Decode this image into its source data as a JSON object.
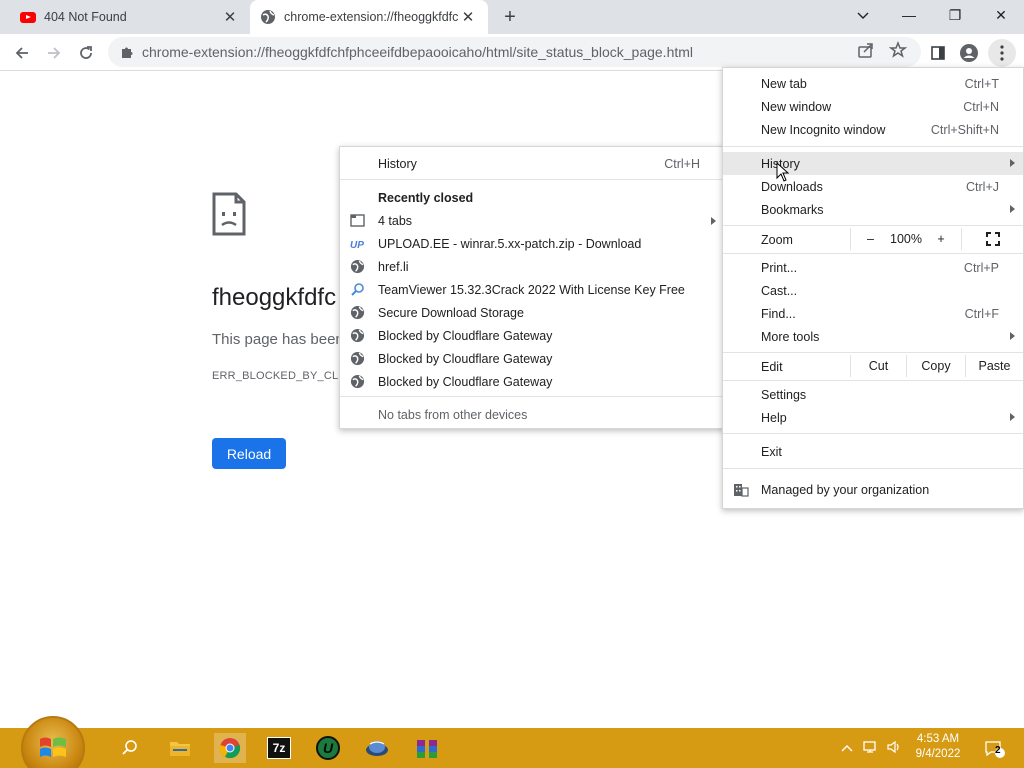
{
  "tabs": [
    {
      "title": "404 Not Found",
      "favicon": "youtube-icon"
    },
    {
      "title": "chrome-extension://fheoggkfdfchfphceeifdbepaooicaho/html/site_status_block_page.html",
      "favicon": "globe-icon",
      "active": true
    }
  ],
  "window_controls": {
    "tabsearch": "⌵",
    "minimize": "—",
    "maximize": "❐",
    "close": "✕"
  },
  "toolbar": {
    "url": "chrome-extension://fheoggkfdfchfphceeifdbepaooicaho/html/site_status_block_page.html"
  },
  "page": {
    "heading": "fheoggkfdfc",
    "description": "This page has been",
    "error_code": "ERR_BLOCKED_BY_CLIEN",
    "reload_label": "Reload"
  },
  "main_menu": {
    "new_tab": {
      "label": "New tab",
      "shortcut": "Ctrl+T"
    },
    "new_window": {
      "label": "New window",
      "shortcut": "Ctrl+N"
    },
    "new_incognito": {
      "label": "New Incognito window",
      "shortcut": "Ctrl+Shift+N"
    },
    "history": {
      "label": "History"
    },
    "downloads": {
      "label": "Downloads",
      "shortcut": "Ctrl+J"
    },
    "bookmarks": {
      "label": "Bookmarks"
    },
    "zoom": {
      "label": "Zoom",
      "minus": "–",
      "value": "100%",
      "plus": "+"
    },
    "print": {
      "label": "Print...",
      "shortcut": "Ctrl+P"
    },
    "cast": {
      "label": "Cast..."
    },
    "find": {
      "label": "Find...",
      "shortcut": "Ctrl+F"
    },
    "more_tools": {
      "label": "More tools"
    },
    "edit": {
      "label": "Edit",
      "cut": "Cut",
      "copy": "Copy",
      "paste": "Paste"
    },
    "settings": {
      "label": "Settings"
    },
    "help": {
      "label": "Help"
    },
    "exit": {
      "label": "Exit"
    },
    "managed": {
      "label": "Managed by your organization"
    }
  },
  "history_menu": {
    "history": {
      "label": "History",
      "shortcut": "Ctrl+H"
    },
    "recently_closed": "Recently closed",
    "items": [
      {
        "label": "4 tabs",
        "icon": "window-icon"
      },
      {
        "label": "UPLOAD.EE - winrar.5.xx-patch.zip - Download",
        "icon": "upload-ee-icon"
      },
      {
        "label": "href.li",
        "icon": "globe-icon"
      },
      {
        "label": "TeamViewer 15.32.3Crack 2022 With License Key Free",
        "icon": "search-icon"
      },
      {
        "label": "Secure Download Storage",
        "icon": "globe-icon"
      },
      {
        "label": "Blocked by Cloudflare Gateway",
        "icon": "globe-icon"
      },
      {
        "label": "Blocked by Cloudflare Gateway",
        "icon": "globe-icon"
      },
      {
        "label": "Blocked by Cloudflare Gateway",
        "icon": "globe-icon"
      }
    ],
    "no_tabs": "No tabs from other devices"
  },
  "taskbar": {
    "time": "4:53 AM",
    "date": "9/4/2022",
    "notification_count": "2",
    "sevenzip_label": "7z",
    "ublock_label": "U"
  },
  "colors": {
    "accent": "#1a73e8",
    "taskbar": "#d69a13"
  }
}
